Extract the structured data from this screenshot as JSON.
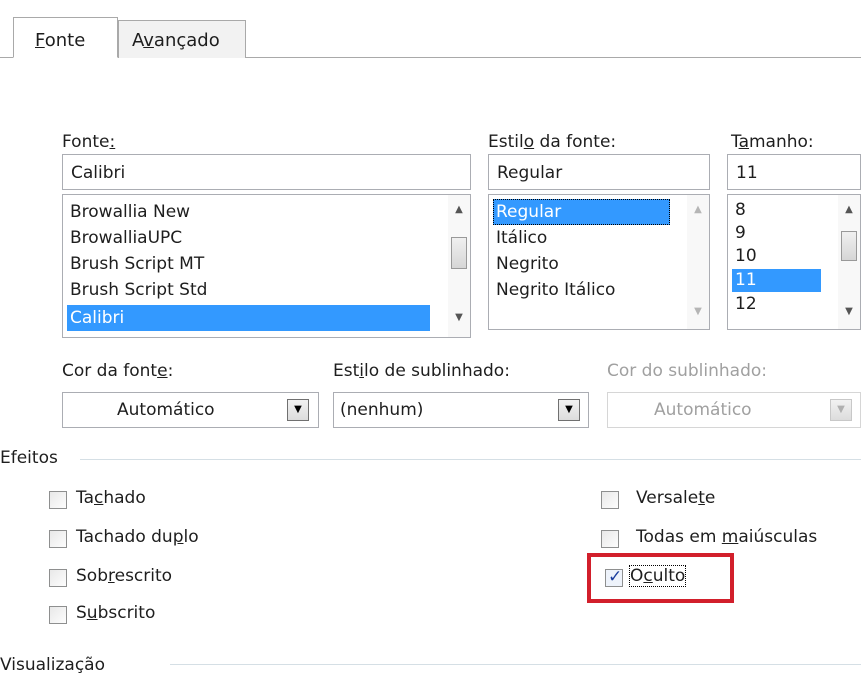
{
  "tabs": [
    {
      "label": "Fonte",
      "hotkey_index": 0
    },
    {
      "label": "Avançado",
      "hotkey_index": 1
    }
  ],
  "font": {
    "label_prefix": "Fonte",
    "label_suffix": ":",
    "value": "Calibri",
    "items": [
      "Browallia New",
      "BrowalliaUPC",
      "Brush Script MT",
      "Brush Script Std",
      "Calibri"
    ],
    "selected": "Calibri"
  },
  "style": {
    "label_pre": "Estil",
    "label_key": "o",
    "label_post": " da fonte:",
    "value": "Regular",
    "items": [
      "Regular",
      "Itálico",
      "Negrito",
      "Negrito Itálico"
    ],
    "selected": "Regular"
  },
  "size": {
    "label_pre": "T",
    "label_key": "a",
    "label_post": "manho:",
    "value": "11",
    "items": [
      "8",
      "9",
      "10",
      "11",
      "12"
    ],
    "selected": "11"
  },
  "font_color": {
    "label_pre": "Cor da font",
    "label_key": "e",
    "label_post": ":",
    "value": "Automático"
  },
  "underline_style": {
    "label_pre": "Est",
    "label_key": "i",
    "label_post": "lo de sublinhado:",
    "value": "(nenhum)"
  },
  "underline_color": {
    "label": "Cor do sublinhado:",
    "value": "Automático"
  },
  "effects": {
    "title": "Efeitos",
    "tachado": {
      "pre": "Ta",
      "key": "c",
      "post": "hado",
      "checked": false
    },
    "tachado_duplo": {
      "pre": "Tachado du",
      "key": "p",
      "post": "lo",
      "checked": false
    },
    "sobrescrito": {
      "pre": "Sob",
      "key": "r",
      "post": "escrito",
      "checked": false
    },
    "subscrito": {
      "pre": "S",
      "key": "u",
      "post": "bscrito",
      "checked": false
    },
    "versalete": {
      "pre": "Versale",
      "key": "t",
      "post": "e",
      "checked": false
    },
    "todas_maiusculas": {
      "pre": "Todas em ",
      "key": "m",
      "post": "aiúsculas",
      "checked": false
    },
    "oculto": {
      "pre": "O",
      "key": "c",
      "post": "ulto",
      "checked": true
    }
  },
  "preview": {
    "title": "Visualização"
  },
  "icons": {
    "arrow_up": "▲",
    "arrow_down": "▼",
    "check": "✓"
  },
  "colors": {
    "selection": "#3399ff",
    "highlight": "#d21f2b"
  }
}
